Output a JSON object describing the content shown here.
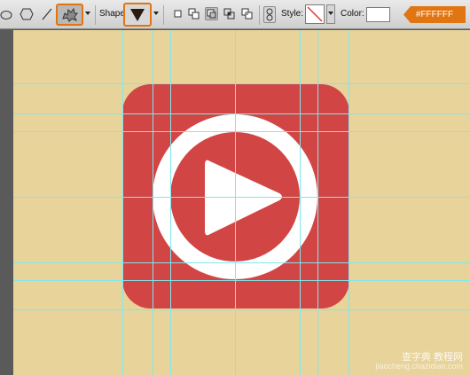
{
  "toolbar": {
    "shape_label": "Shape",
    "style_label": "Style:",
    "color_label": "Color:",
    "color_hex": "#FFFFFF",
    "color_swatch": "#ffffff",
    "accent": "#e07512",
    "tools": [
      "ellipse-tool-icon",
      "polygon-tool-icon",
      "line-tool-icon",
      "custom-shape-tool-icon"
    ],
    "shape_preset": "triangle-shape",
    "path_operations": [
      "new-layer",
      "add",
      "subtract",
      "intersect",
      "exclude"
    ],
    "active_operation": "subtract"
  },
  "canvas": {
    "background": "#e8d39a",
    "icon_color": "#d24545",
    "play_color": "#ffffff",
    "guide_color": "#7fe8ee"
  },
  "watermark": {
    "title": "查字典 教程网",
    "url": "jiaocheng.chazidian.com"
  }
}
